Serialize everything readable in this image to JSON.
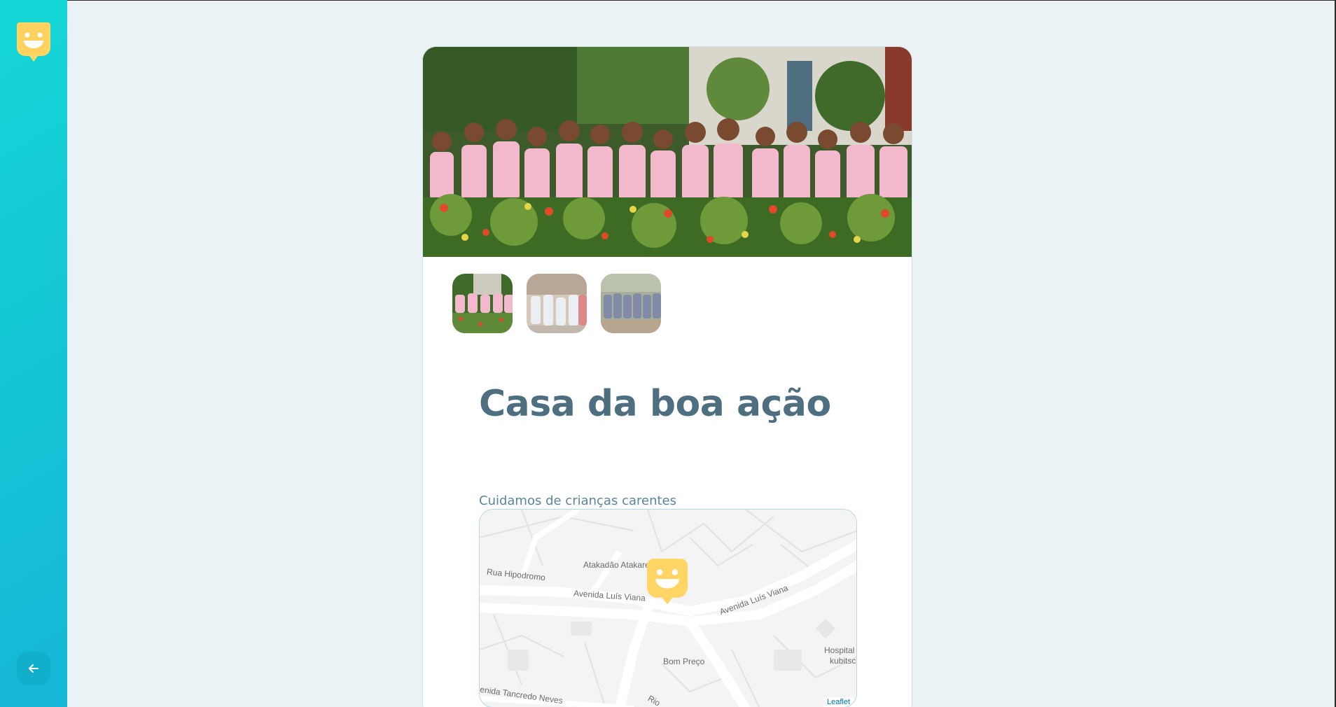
{
  "sidebar": {
    "logo_icon": "happy-face-marker-icon",
    "back_icon": "arrow-left-icon"
  },
  "orphanage": {
    "name": "Casa da boa ação",
    "description": "Cuidamos de crianças carentes",
    "images": [
      {
        "alt": "kids-pink-shirts",
        "active": true
      },
      {
        "alt": "group-photo-2",
        "active": false
      },
      {
        "alt": "group-photo-3",
        "active": false
      }
    ]
  },
  "map": {
    "labels": {
      "atakadao": "Atakadão Atakarejo",
      "rua_hipodromo": "Rua Hipodromo",
      "av_luis_viana_1": "Avenida Luís Viana",
      "av_luis_viana_2": "Avenida Luís Viana",
      "bom_preco": "Bom Preço",
      "hospital": "Hospital",
      "kubitschek": "kubitsc",
      "av_tancredo": "enida Tancredo Neves",
      "rio": "Rio"
    },
    "attribution": "Leaflet",
    "marker_icon": "happy-face-marker-icon"
  },
  "colors": {
    "sidebar_from": "#15b6d6",
    "sidebar_to": "#15d6d6",
    "title": "#4d6f80",
    "marker": "#ffd666"
  }
}
